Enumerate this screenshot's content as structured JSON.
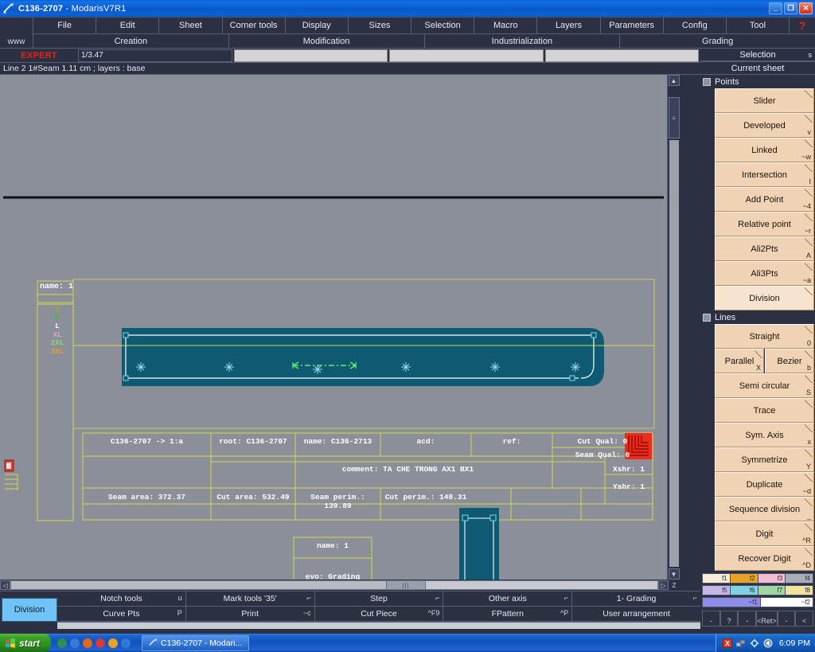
{
  "window": {
    "title": "C136-2707",
    "subtitle": " - ModarisV7R1",
    "minimize": "_",
    "restore": "❐",
    "close": "✕"
  },
  "menu": {
    "www_label": "www",
    "row1": [
      {
        "label": "File"
      },
      {
        "label": "Edit"
      },
      {
        "label": "Sheet"
      },
      {
        "label": "Corner tools"
      },
      {
        "label": "Display"
      },
      {
        "label": "Sizes"
      },
      {
        "label": "Selection"
      },
      {
        "label": "Macro"
      },
      {
        "label": "Layers"
      },
      {
        "label": "Parameters"
      },
      {
        "label": "Config"
      },
      {
        "label": "Tool"
      }
    ],
    "help_glyph": "?",
    "row2": [
      {
        "label": "Creation"
      },
      {
        "label": "Modification"
      },
      {
        "label": "Industrialization"
      },
      {
        "label": "Grading"
      }
    ]
  },
  "expert": {
    "label": "EXPERT",
    "field1": "1/3.47",
    "field2": "",
    "field3": "",
    "field4": ""
  },
  "status": {
    "text": "Line 2 1#Seam 1.11 cm ;   layers : base"
  },
  "canvas": {
    "piece_name_label": "name: 1",
    "sizes": [
      {
        "name": "S",
        "color": "#a3a832"
      },
      {
        "name": "M",
        "color": "#2fc14a"
      },
      {
        "name": "L",
        "color": "#ffffff"
      },
      {
        "name": "XL",
        "color": "#e89ad2"
      },
      {
        "name": "2XL",
        "color": "#8fd86f"
      },
      {
        "name": "3XL",
        "color": "#e2a23a"
      }
    ],
    "info_table": {
      "path": "C136-2707 -> 1:a",
      "root": "root: C136-2707",
      "name": "name: C136-2713",
      "acd": "acd:",
      "ref": "ref:",
      "cut_qual": "Cut Qual: 0",
      "seam_qual": "Seam Qual: 0",
      "comment": "comment: TA CHE TRONG AX1 BX1",
      "xshr": "Xshr: 1",
      "yshr": "Yshr: 1",
      "seam_area": "Seam area: 372.37",
      "cut_area": "Cut area: 532.49",
      "seam_perim": "Seam perim.: 139.89",
      "cut_perim": "Cut perim.: 148.31"
    },
    "second_piece": {
      "name": "name: 1",
      "evo": "evo: Grading"
    }
  },
  "scrollbars": {
    "up": "▲",
    "down": "▼",
    "left": "◁",
    "right": "▷",
    "z_label": "Z",
    "grip": "|||",
    "grip_v": "≡"
  },
  "bottom_toolbar": {
    "division_label": "Division",
    "row1": [
      {
        "label": "Notch tools",
        "key": "u"
      },
      {
        "label": "Mark tools '35'",
        "key": "⌐"
      },
      {
        "label": "Step",
        "key": "⌐"
      },
      {
        "label": "Other axis",
        "key": "⌐"
      },
      {
        "label": "1- Grading",
        "key": "⌐"
      }
    ],
    "row2": [
      {
        "label": "Curve Pts",
        "key": "P"
      },
      {
        "label": "Print",
        "key": "~c"
      },
      {
        "label": "Cut Piece",
        "key": "^F9"
      },
      {
        "label": "FPattern",
        "key": "^P"
      },
      {
        "label": "User arrangement",
        "key": ""
      }
    ]
  },
  "right_panel": {
    "header_selection": {
      "label": "Selection",
      "key": "s"
    },
    "header_current_sheet": {
      "label": "Current sheet",
      "key": ""
    },
    "groups": [
      {
        "label": "Points",
        "items": [
          {
            "label": "Slider",
            "key": "",
            "selected": false
          },
          {
            "label": "Developed",
            "key": "v",
            "selected": false
          },
          {
            "label": "Linked",
            "key": "~w",
            "selected": false
          },
          {
            "label": "Intersection",
            "key": "I",
            "selected": false
          },
          {
            "label": "Add Point",
            "key": "~4",
            "selected": false
          },
          {
            "label": "Relative point",
            "key": "~r",
            "selected": false
          },
          {
            "label": "Ali2Pts",
            "key": "A",
            "selected": false
          },
          {
            "label": "Ali3Pts",
            "key": "~a",
            "selected": false
          },
          {
            "label": "Division",
            "key": "",
            "selected": true
          }
        ]
      },
      {
        "label": "Lines",
        "items": [
          {
            "label": "Straight",
            "key": "0",
            "selected": false
          },
          {
            "label": "Parallel",
            "key": "X",
            "selected": false,
            "pair": true
          },
          {
            "label": "Bezier",
            "key": "b",
            "selected": false,
            "pair": true
          },
          {
            "label": "Semi circular",
            "key": "S",
            "selected": false
          },
          {
            "label": "Trace",
            "key": "",
            "selected": false
          },
          {
            "label": "Sym. Axis",
            "key": "x",
            "selected": false
          },
          {
            "label": "Symmetrize",
            "key": "Y",
            "selected": false
          },
          {
            "label": "Duplicate",
            "key": "~d",
            "selected": false
          },
          {
            "label": "Sequence division",
            "key": "_",
            "selected": false
          },
          {
            "label": "Digit",
            "key": "^R",
            "selected": false
          },
          {
            "label": "Recover Digit",
            "key": "^D",
            "selected": false
          }
        ]
      }
    ],
    "fkeys_row1": [
      {
        "label": "f1",
        "color": "#f7ecd8"
      },
      {
        "label": "f2",
        "color": "#e8a424"
      },
      {
        "label": "f3",
        "color": "#f3bcd3"
      },
      {
        "label": "f4",
        "color": "#a8aeb8"
      }
    ],
    "fkeys_row2": [
      {
        "label": "f5",
        "color": "#c8b6e8"
      },
      {
        "label": "f6",
        "color": "#7dd3e0"
      },
      {
        "label": "f7",
        "color": "#9fd6a4"
      },
      {
        "label": "f8",
        "color": "#f2e39a"
      }
    ],
    "fkeys_row3": [
      {
        "label": "~f1",
        "color": "#8d8de8"
      },
      {
        "label": "~f2",
        "color": "#ffffff"
      }
    ],
    "bottom_keys": [
      {
        "label": "-"
      },
      {
        "label": "?"
      },
      {
        "label": "-"
      },
      {
        "label": "<Ret>"
      },
      {
        "label": "-"
      },
      {
        "label": "<"
      }
    ]
  },
  "taskbar": {
    "start_label": "start",
    "task_title": "C136-2707  - Modari...",
    "clock": "6:09 PM"
  },
  "colors": {
    "accent_blue": "#1452bd",
    "panel_peach": "#f0d3b4",
    "canvas_gray": "#8a8f99",
    "piece_teal": "#0d5a72",
    "frame_yellow": "#d7d84a",
    "expert_red": "#e8231a",
    "division_blue": "#6fc3f7"
  }
}
